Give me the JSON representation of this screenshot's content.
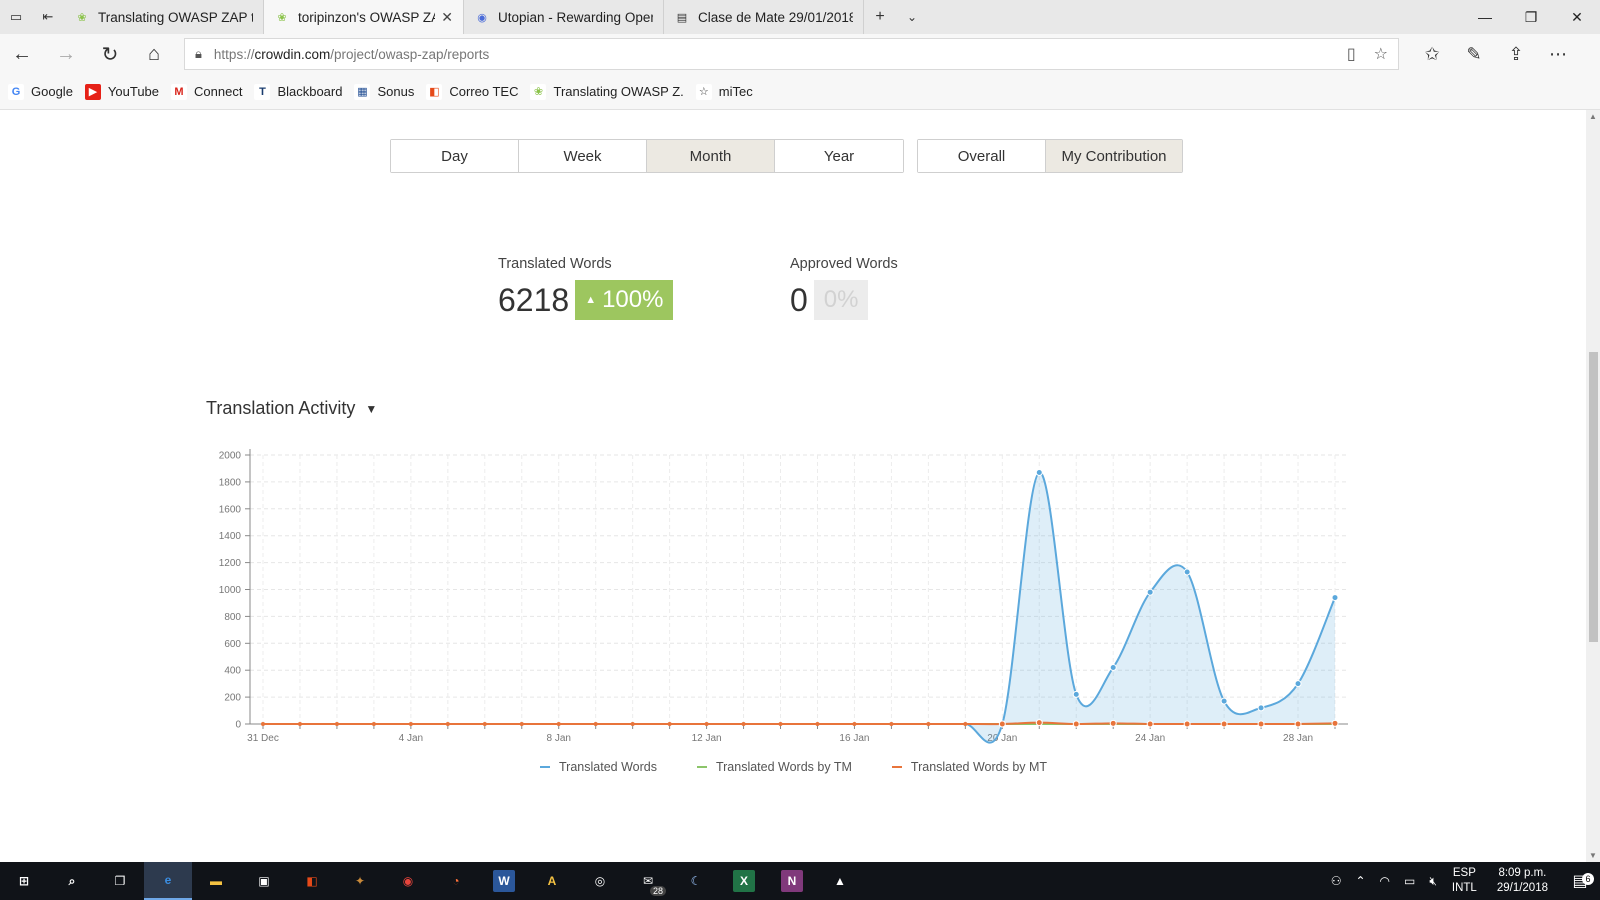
{
  "browser": {
    "tabs": [
      {
        "label": "Translating OWASP ZAP to S",
        "icon": "crowdin-icon",
        "active": false
      },
      {
        "label": "toripinzon's OWASP ZAP",
        "icon": "crowdin-icon",
        "active": true
      },
      {
        "label": "Utopian - Rewarding Open",
        "icon": "utopian-icon",
        "active": false
      },
      {
        "label": "Clase de Mate 29/01/2018",
        "icon": "page-icon",
        "active": false
      }
    ],
    "url_prefix": "https://",
    "url_host": "crowdin.com",
    "url_path": "/project/owasp-zap/reports"
  },
  "favorites": [
    {
      "label": "Google",
      "icon": "google-icon",
      "color": "#ffffff",
      "glyph": "G",
      "glyph_color": "#4285f4"
    },
    {
      "label": "YouTube",
      "icon": "youtube-icon",
      "color": "#e62117",
      "glyph": "▶",
      "glyph_color": "#ffffff"
    },
    {
      "label": "Connect",
      "icon": "connect-icon",
      "color": "#ffffff",
      "glyph": "M",
      "glyph_color": "#d9261c"
    },
    {
      "label": "Blackboard",
      "icon": "blackboard-icon",
      "color": "#ffffff",
      "glyph": "T",
      "glyph_color": "#1a3c6e"
    },
    {
      "label": "Sonus",
      "icon": "sonus-icon",
      "color": "#ffffff",
      "glyph": "▦",
      "glyph_color": "#1d4a91"
    },
    {
      "label": "Correo TEC",
      "icon": "office-icon",
      "color": "#ffffff",
      "glyph": "◧",
      "glyph_color": "#e64a19"
    },
    {
      "label": "Translating OWASP Z.",
      "icon": "crowdin-icon",
      "color": "#ffffff",
      "glyph": "❀",
      "glyph_color": "#8bc34a"
    },
    {
      "label": "miTec",
      "icon": "star-icon",
      "color": "#ffffff",
      "glyph": "☆",
      "glyph_color": "#333333"
    }
  ],
  "period_buttons": [
    "Day",
    "Week",
    "Month",
    "Year"
  ],
  "period_active": "Month",
  "scope_buttons": [
    "Overall",
    "My Contribution"
  ],
  "scope_active": "My Contribution",
  "stats": {
    "translated": {
      "label": "Translated Words",
      "value": "6218",
      "change": "100%"
    },
    "approved": {
      "label": "Approved Words",
      "value": "0",
      "change": "0%"
    }
  },
  "section_title": "Translation Activity",
  "chart_data": {
    "type": "area",
    "x_tick_labels": [
      "31 Dec",
      "4 Jan",
      "8 Jan",
      "12 Jan",
      "16 Jan",
      "20 Jan",
      "24 Jan",
      "28 Jan"
    ],
    "x": [
      "31 Dec",
      "1 Jan",
      "2 Jan",
      "3 Jan",
      "4 Jan",
      "5 Jan",
      "6 Jan",
      "7 Jan",
      "8 Jan",
      "9 Jan",
      "10 Jan",
      "11 Jan",
      "12 Jan",
      "13 Jan",
      "14 Jan",
      "15 Jan",
      "16 Jan",
      "17 Jan",
      "18 Jan",
      "19 Jan",
      "20 Jan",
      "21 Jan",
      "22 Jan",
      "23 Jan",
      "24 Jan",
      "25 Jan",
      "26 Jan",
      "27 Jan",
      "28 Jan",
      "29 Jan"
    ],
    "ylim": [
      0,
      2000
    ],
    "y_ticks": [
      0,
      200,
      400,
      600,
      800,
      1000,
      1200,
      1400,
      1600,
      1800,
      2000
    ],
    "grid": true,
    "legend_position": "bottom",
    "series": [
      {
        "name": "Translated Words",
        "color": "#5ba8dc",
        "values": [
          0,
          0,
          0,
          0,
          0,
          0,
          0,
          0,
          0,
          0,
          0,
          0,
          0,
          0,
          0,
          0,
          0,
          0,
          0,
          0,
          0,
          1870,
          220,
          420,
          980,
          1130,
          170,
          120,
          300,
          940
        ]
      },
      {
        "name": "Translated Words by TM",
        "color": "#8cc56a",
        "values": [
          0,
          0,
          0,
          0,
          0,
          0,
          0,
          0,
          0,
          0,
          0,
          0,
          0,
          0,
          0,
          0,
          0,
          0,
          0,
          0,
          0,
          0,
          0,
          0,
          0,
          0,
          0,
          0,
          0,
          0
        ]
      },
      {
        "name": "Translated Words by MT",
        "color": "#e8743b",
        "values": [
          0,
          0,
          0,
          0,
          0,
          0,
          0,
          0,
          0,
          0,
          0,
          0,
          0,
          0,
          0,
          0,
          0,
          0,
          0,
          0,
          0,
          10,
          0,
          5,
          0,
          0,
          0,
          0,
          0,
          5
        ]
      }
    ]
  },
  "taskbar": {
    "apps": [
      {
        "name": "start-button",
        "glyph": "⊞",
        "color": "#ffffff",
        "bg": "transparent"
      },
      {
        "name": "search-icon",
        "glyph": "⌕",
        "color": "#ffffff",
        "bg": "transparent"
      },
      {
        "name": "task-view-icon",
        "glyph": "❐",
        "color": "#ffffff",
        "bg": "transparent"
      },
      {
        "name": "edge-icon",
        "glyph": "e",
        "color": "#3b8de0",
        "bg": "transparent",
        "active": true
      },
      {
        "name": "file-explorer-icon",
        "glyph": "▬",
        "color": "#f5c242",
        "bg": "transparent"
      },
      {
        "name": "store-icon",
        "glyph": "▣",
        "color": "#ffffff",
        "bg": "transparent"
      },
      {
        "name": "office-icon",
        "glyph": "◧",
        "color": "#e64a19",
        "bg": "transparent"
      },
      {
        "name": "game-icon",
        "glyph": "✦",
        "color": "#c98a3a",
        "bg": "transparent"
      },
      {
        "name": "chrome-icon",
        "glyph": "◉",
        "color": "#e8453c",
        "bg": "transparent"
      },
      {
        "name": "firefox-icon",
        "glyph": "◔",
        "color": "#ff7139",
        "bg": "transparent"
      },
      {
        "name": "word-icon",
        "glyph": "W",
        "color": "#ffffff",
        "bg": "#2b579a"
      },
      {
        "name": "arduino-icon",
        "glyph": "A",
        "color": "#f5c242",
        "bg": "transparent"
      },
      {
        "name": "media-icon",
        "glyph": "◎",
        "color": "#ffffff",
        "bg": "transparent"
      },
      {
        "name": "mail-icon",
        "glyph": "✉",
        "color": "#ffffff",
        "bg": "transparent",
        "badge": "28"
      },
      {
        "name": "moon-app-icon",
        "glyph": "☾",
        "color": "#9ec7ff",
        "bg": "transparent"
      },
      {
        "name": "excel-icon",
        "glyph": "X",
        "color": "#ffffff",
        "bg": "#217346"
      },
      {
        "name": "onenote-icon",
        "glyph": "N",
        "color": "#ffffff",
        "bg": "#80397b"
      },
      {
        "name": "photos-icon",
        "glyph": "▲",
        "color": "#ffffff",
        "bg": "transparent"
      }
    ],
    "lang_top": "ESP",
    "lang_bottom": "INTL",
    "time": "8:09 p.m.",
    "date": "29/1/2018",
    "notifications": "6"
  }
}
